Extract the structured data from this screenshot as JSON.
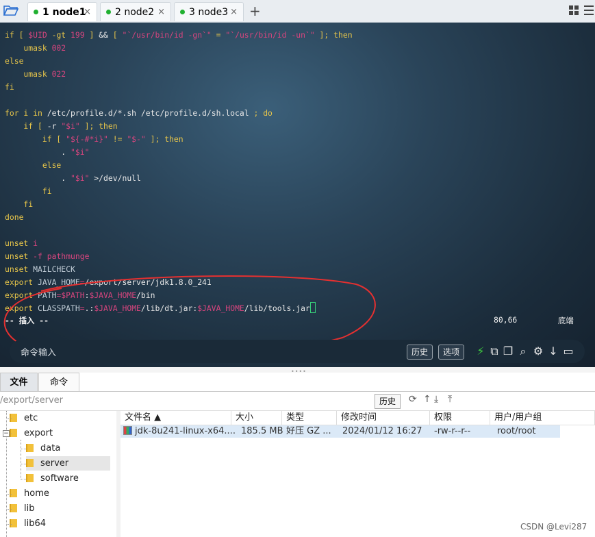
{
  "tabs": [
    {
      "label": "1 node1",
      "active": true
    },
    {
      "label": "2 node2",
      "active": false
    },
    {
      "label": "3 node3",
      "active": false
    }
  ],
  "tab_close": "×",
  "tab_add": "+",
  "terminal": {
    "lines": [
      [
        [
          "k",
          "if [ "
        ],
        [
          "v",
          "$UID"
        ],
        [
          "k",
          " -gt "
        ],
        [
          "v",
          "199"
        ],
        [
          "k",
          " ] "
        ],
        [
          "q",
          "&& "
        ],
        [
          "k",
          "[ "
        ],
        [
          "s",
          "\"`/usr/bin/id -gn`\""
        ],
        [
          "k",
          " = "
        ],
        [
          "s",
          "\"`/usr/bin/id -un`\""
        ],
        [
          "k",
          " ]; then"
        ]
      ],
      [
        [
          "k",
          "    umask "
        ],
        [
          "v",
          "002"
        ]
      ],
      [
        [
          "k",
          "else"
        ]
      ],
      [
        [
          "k",
          "    umask "
        ],
        [
          "v",
          "022"
        ]
      ],
      [
        [
          "k",
          "fi"
        ]
      ],
      [],
      [
        [
          "k",
          "for i in "
        ],
        [
          "q",
          "/etc/profile.d/*.sh /etc/profile.d/sh.local "
        ],
        [
          "k",
          "; do"
        ]
      ],
      [
        [
          "k",
          "    if [ "
        ],
        [
          "q",
          "-r "
        ],
        [
          "s",
          "\"$i\""
        ],
        [
          "k",
          " ]; then"
        ]
      ],
      [
        [
          "k",
          "        if [ "
        ],
        [
          "s",
          "\"${-#*i}\""
        ],
        [
          "k",
          " != "
        ],
        [
          "s",
          "\"$-\""
        ],
        [
          "k",
          " ]; then"
        ]
      ],
      [
        [
          "q",
          "            . "
        ],
        [
          "s",
          "\"$i\""
        ]
      ],
      [
        [
          "k",
          "        else"
        ]
      ],
      [
        [
          "q",
          "            . "
        ],
        [
          "s",
          "\"$i\""
        ],
        [
          "q",
          " >/dev/null"
        ]
      ],
      [
        [
          "k",
          "        fi"
        ]
      ],
      [
        [
          "k",
          "    fi"
        ]
      ],
      [
        [
          "k",
          "done"
        ]
      ],
      [],
      [
        [
          "k",
          "unset "
        ],
        [
          "v",
          "i"
        ]
      ],
      [
        [
          "k",
          "unset "
        ],
        [
          "v",
          "-f pathmunge"
        ]
      ],
      [
        [
          "k",
          "unset "
        ],
        [
          "p",
          "MAILCHECK"
        ]
      ],
      [
        [
          "k",
          "export "
        ],
        [
          "p",
          "JAVA_HOME"
        ],
        [
          "v",
          "="
        ],
        [
          "q",
          "/export/server/jdk1.8.0_241"
        ]
      ],
      [
        [
          "k",
          "export "
        ],
        [
          "p",
          "PATH"
        ],
        [
          "v",
          "=$PATH"
        ],
        [
          "q",
          ":"
        ],
        [
          "v",
          "$JAVA_HOME"
        ],
        [
          "q",
          "/bin"
        ]
      ],
      [
        [
          "k",
          "export "
        ],
        [
          "p",
          "CLASSPATH"
        ],
        [
          "v",
          "="
        ],
        [
          "q",
          ".:"
        ],
        [
          "v",
          "$JAVA_HOME"
        ],
        [
          "q",
          "/lib/dt.jar:"
        ],
        [
          "v",
          "$JAVA_HOME"
        ],
        [
          "q",
          "/lib/tools.jar"
        ]
      ]
    ],
    "mode": "-- 插入 --",
    "position": "80,66",
    "scroll": "底端"
  },
  "command_bar": {
    "placeholder": "命令输入",
    "history_button": "历史",
    "options_button": "选项",
    "icons": [
      "lightning-icon",
      "copy-icon",
      "paste-icon",
      "search-icon",
      "gear-icon",
      "download-arrow-icon",
      "window-icon"
    ]
  },
  "bottom_tabs": [
    {
      "label": "文件",
      "active": true
    },
    {
      "label": "命令",
      "active": false
    }
  ],
  "path_bar": {
    "path": "/export/server",
    "history_button": "历史"
  },
  "tree": [
    {
      "label": "etc",
      "indent": 0,
      "selected": false
    },
    {
      "label": "export",
      "indent": 0,
      "selected": false,
      "expanded": true
    },
    {
      "label": "data",
      "indent": 1,
      "selected": false
    },
    {
      "label": "server",
      "indent": 1,
      "selected": true
    },
    {
      "label": "software",
      "indent": 1,
      "selected": false
    },
    {
      "label": "home",
      "indent": 0,
      "selected": false
    },
    {
      "label": "lib",
      "indent": 0,
      "selected": false
    },
    {
      "label": "lib64",
      "indent": 0,
      "selected": false
    }
  ],
  "table": {
    "headers": [
      "文件名 ▲",
      "大小",
      "类型",
      "修改时间",
      "权限",
      "用户/用户组"
    ],
    "rows": [
      [
        "jdk-8u241-linux-x64....",
        "185.5 MB",
        "好压 GZ ...",
        "2024/01/12 16:27",
        "-rw-r--r--",
        "root/root"
      ]
    ]
  },
  "watermark": "CSDN @Levi287",
  "colors": {
    "keyword": "#e8c64a",
    "variable": "#d7457e",
    "annotation": "#e53030"
  }
}
